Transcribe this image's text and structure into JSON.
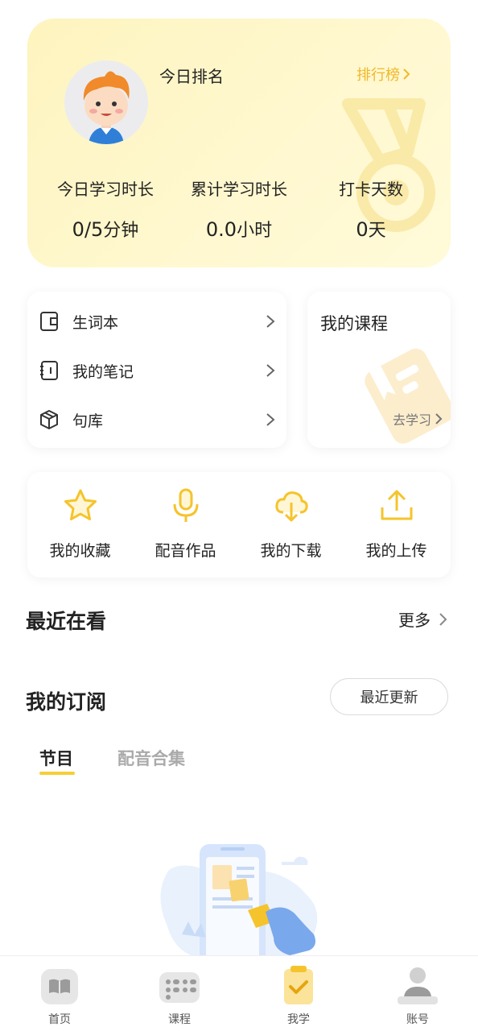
{
  "stats": {
    "rank_title": "今日排名",
    "leaderboard_link": "排行榜",
    "items": [
      {
        "label": "今日学习时长",
        "value": "0/5",
        "unit": "分钟"
      },
      {
        "label": "累计学习时长",
        "value": "0.0",
        "unit": "小时"
      },
      {
        "label": "打卡天数",
        "value": "0",
        "unit": "天"
      }
    ]
  },
  "tools": [
    {
      "label": "生词本",
      "icon": "wordbook-icon"
    },
    {
      "label": "我的笔记",
      "icon": "notebook-icon"
    },
    {
      "label": "句库",
      "icon": "cube-icon"
    }
  ],
  "course": {
    "title": "我的课程",
    "link": "去学习"
  },
  "actions": [
    {
      "label": "我的收藏",
      "icon": "star-icon"
    },
    {
      "label": "配音作品",
      "icon": "microphone-icon"
    },
    {
      "label": "我的下载",
      "icon": "cloud-download-icon"
    },
    {
      "label": "我的上传",
      "icon": "upload-icon"
    }
  ],
  "recent": {
    "title": "最近在看",
    "more": "更多"
  },
  "subscription": {
    "title": "我的订阅",
    "sort_button": "最近更新",
    "tabs": [
      "节目",
      "配音合集"
    ],
    "active_tab": "节目"
  },
  "nav": [
    {
      "label": "首页",
      "icon": "book-icon",
      "active": false
    },
    {
      "label": "课程",
      "icon": "grid-icon",
      "active": false
    },
    {
      "label": "我学",
      "icon": "clipboard-check-icon",
      "active": true
    },
    {
      "label": "账号",
      "icon": "user-icon",
      "active": false
    }
  ],
  "colors": {
    "accent": "#f5cf37",
    "accent_text": "#f0b82a",
    "card_bg": "#fdf4bf"
  }
}
